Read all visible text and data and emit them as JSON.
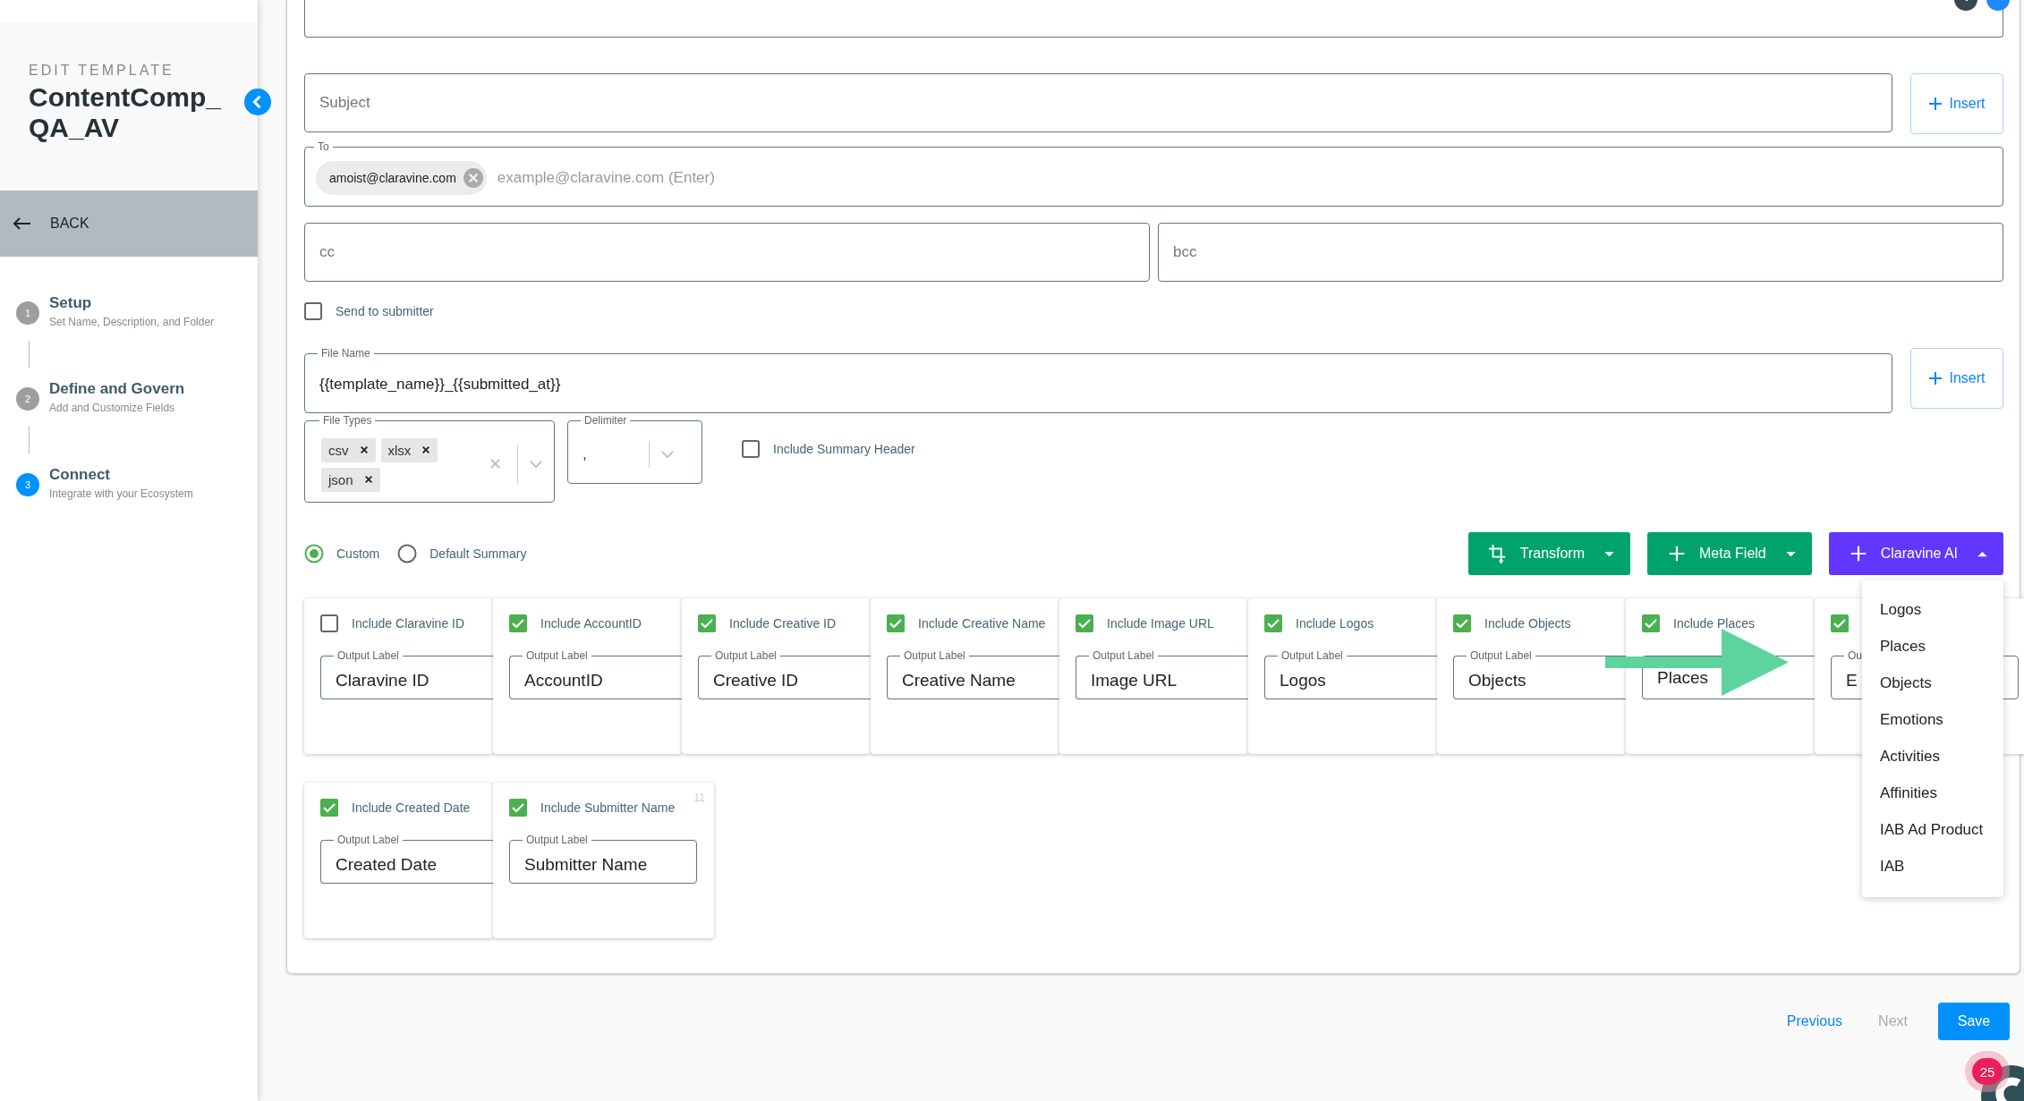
{
  "sidebar": {
    "eyebrow": "EDIT TEMPLATE",
    "title": "ContentComp_QA_AV",
    "back": {
      "label": "BACK"
    },
    "steps": [
      {
        "number": "1",
        "title": "Setup",
        "subtitle": "Set Name, Description, and Folder",
        "selected": false
      },
      {
        "number": "2",
        "title": "Define and Govern",
        "subtitle": "Add and Customize Fields",
        "selected": false
      },
      {
        "number": "3",
        "title": "Connect",
        "subtitle": "Integrate with your Ecosystem",
        "selected": true
      }
    ]
  },
  "form": {
    "subject": {
      "placeholder": "Subject",
      "insert": "Insert"
    },
    "to": {
      "label": "To",
      "chips": [
        "amoist@claravine.com"
      ],
      "placeholder": "example@claravine.com (Enter)"
    },
    "cc": {
      "placeholder": "cc"
    },
    "bcc": {
      "placeholder": "bcc"
    },
    "send_to_submitter": {
      "label": "Send to submitter",
      "checked": false
    },
    "file_name": {
      "label": "File Name",
      "value": "{{template_name}}_{{submitted_at}}",
      "insert": "Insert"
    },
    "file_types": {
      "label": "File Types",
      "chips": [
        "csv",
        "xlsx",
        "json"
      ]
    },
    "delimiter": {
      "label": "Delimiter",
      "value": ","
    },
    "include_summary_header": {
      "label": "Include Summary Header",
      "checked": false
    },
    "summary_mode": [
      {
        "label": "Custom",
        "selected": true
      },
      {
        "label": "Default Summary",
        "selected": false
      }
    ],
    "actions": [
      {
        "kind": "transform",
        "label": "Transform",
        "expanded": false
      },
      {
        "kind": "add",
        "label": "Meta Field",
        "expanded": false
      },
      {
        "kind": "ai",
        "label": "Claravine AI",
        "expanded": true,
        "menu": [
          "Logos",
          "Places",
          "Objects",
          "Emotions",
          "Activities",
          "Affinities",
          "IAB Ad Product",
          "IAB"
        ]
      }
    ],
    "field_card_rows": [
      {
        "cards": [
          {
            "label": "Include Claravine ID",
            "checked": false,
            "output_label": "Output Label",
            "value": "Claravine ID"
          },
          {
            "label": "Include AccountID",
            "checked": true,
            "output_label": "Output Label",
            "value": "AccountID"
          },
          {
            "label": "Include Creative ID",
            "checked": true,
            "output_label": "Output Label",
            "value": "Creative ID"
          },
          {
            "label": "Include Creative Name",
            "checked": true,
            "output_label": "Output Label",
            "value": "Creative Name"
          },
          {
            "label": "Include Image URL",
            "checked": true,
            "output_label": "Output Label",
            "value": "Image URL"
          },
          {
            "label": "Include Logos",
            "checked": true,
            "output_label": "Output Label",
            "value": "Logos"
          },
          {
            "label": "Include Objects",
            "checked": true,
            "output_label": "Output Label",
            "value": "Objects"
          },
          {
            "label": "Include Places",
            "checked": true,
            "value": "Places"
          },
          {
            "checked": true,
            "output_label": "Ou",
            "value": "E"
          }
        ]
      },
      {
        "cards": [
          {
            "label": "Include Created Date",
            "checked": true,
            "output_label": "Output Label",
            "value": "Created Date"
          },
          {
            "label": "Include Submitter Name",
            "checked": true,
            "output_label": "Output Label",
            "value": "Submitter Name",
            "number": "11"
          }
        ]
      }
    ]
  },
  "footer": {
    "previous": {
      "label": "Previous",
      "disabled": false
    },
    "next": {
      "label": "Next",
      "disabled": true
    },
    "save": {
      "label": "Save"
    }
  },
  "notification_badge": "25"
}
